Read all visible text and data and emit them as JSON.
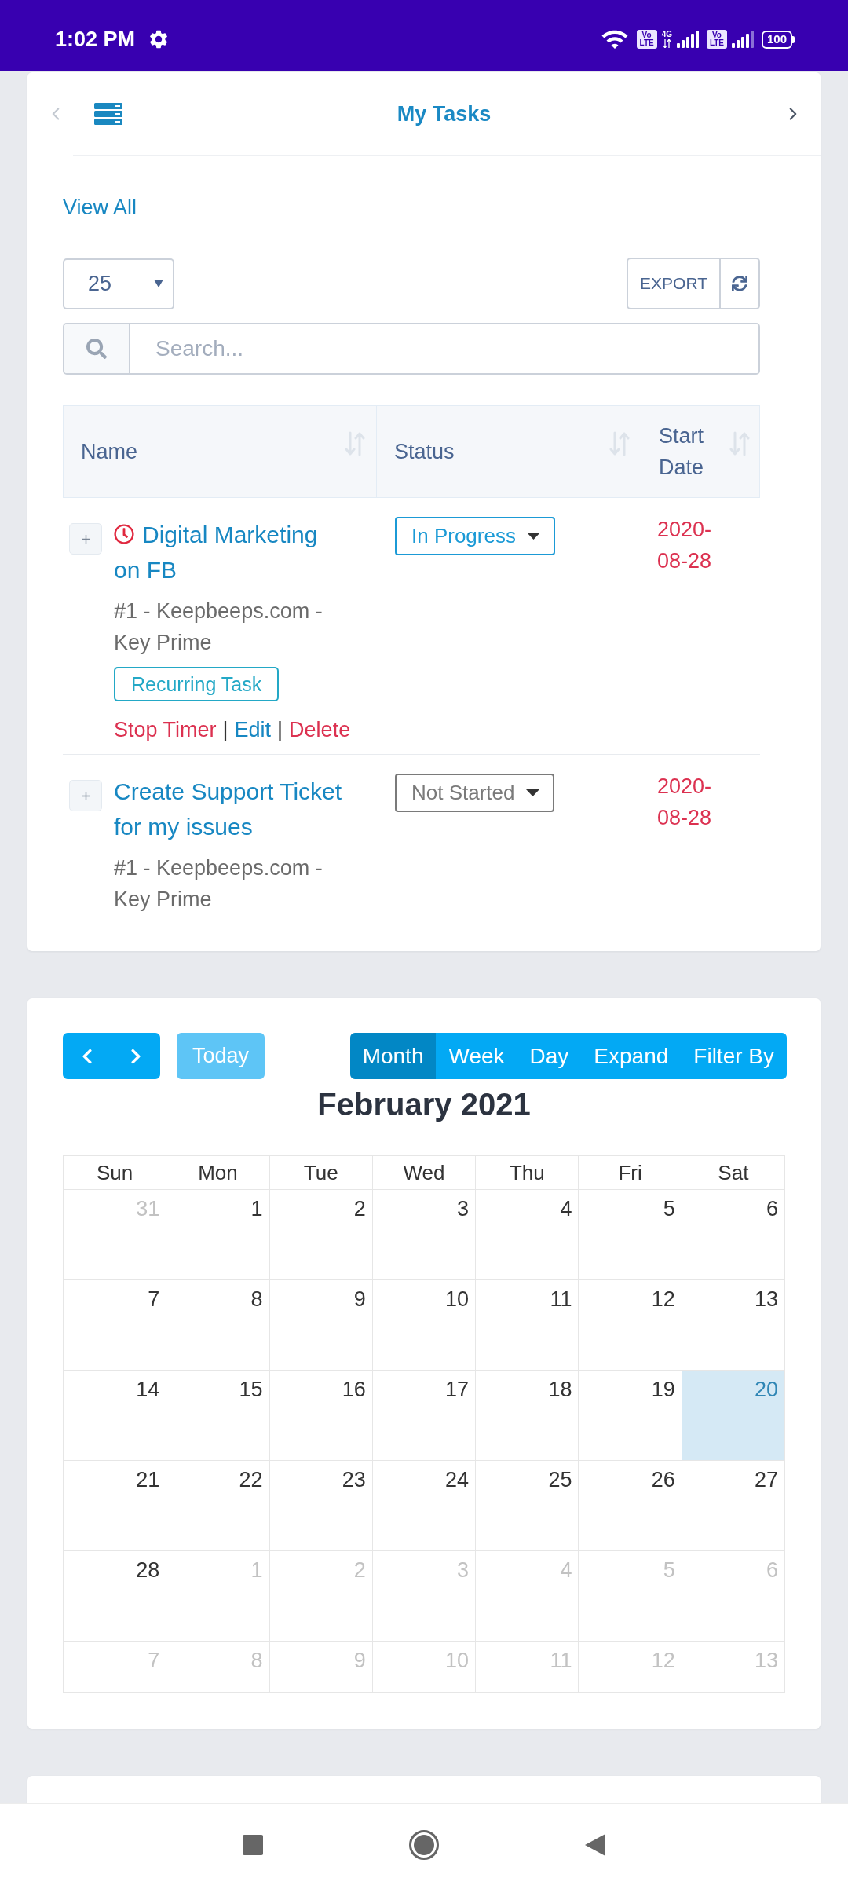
{
  "status_bar": {
    "time": "1:02 PM",
    "sims": [
      {
        "badge": "Vo LTE",
        "network": "4G"
      },
      {
        "badge": "Vo LTE"
      }
    ],
    "battery": "100"
  },
  "tasks": {
    "nav": {
      "prev": {
        "disabled": true
      },
      "next": {
        "disabled": false
      }
    },
    "title": "My Tasks",
    "view_all": "View All",
    "page_size": "25",
    "export": "EXPORT",
    "search": {
      "placeholder": "Search..."
    },
    "columns": [
      "Name",
      "Status",
      "Start Date"
    ],
    "rows": [
      {
        "title": "Digital Marketing on FB",
        "timer_running": true,
        "project": "#1 - Keepbeeps.com - Key Prime",
        "tags": [
          "Recurring Task"
        ],
        "actions": [
          {
            "label": "Stop Timer",
            "kind": "danger"
          },
          {
            "label": "|",
            "kind": "separator"
          },
          {
            "label": "Edit",
            "kind": "link"
          },
          {
            "label": "|",
            "kind": "separator"
          },
          {
            "label": "Delete",
            "kind": "danger"
          }
        ],
        "status": {
          "label": "In Progress",
          "kind": "in_progress"
        },
        "start_date": "2020-08-28"
      },
      {
        "title": "Create Support Ticket for my issues",
        "timer_running": false,
        "project": "#1 - Keepbeeps.com - Key Prime",
        "status": {
          "label": "Not Started",
          "kind": "not_started"
        },
        "start_date": "2020-08-28"
      }
    ]
  },
  "calendar": {
    "today_button": {
      "label": "Today",
      "disabled": true
    },
    "views": [
      {
        "label": "Month",
        "selected": true
      },
      {
        "label": "Week",
        "selected": false
      },
      {
        "label": "Day",
        "selected": false
      },
      {
        "label": "Expand",
        "selected": false
      },
      {
        "label": "Filter By",
        "selected": false
      }
    ],
    "title": "February 2021",
    "weekdays": [
      "Sun",
      "Mon",
      "Tue",
      "Wed",
      "Thu",
      "Fri",
      "Sat"
    ],
    "weeks": [
      [
        {
          "day": "31",
          "other_month": true,
          "today": false
        },
        {
          "day": "1",
          "other_month": false,
          "today": false
        },
        {
          "day": "2",
          "other_month": false,
          "today": false
        },
        {
          "day": "3",
          "other_month": false,
          "today": false
        },
        {
          "day": "4",
          "other_month": false,
          "today": false
        },
        {
          "day": "5",
          "other_month": false,
          "today": false
        },
        {
          "day": "6",
          "other_month": false,
          "today": false
        }
      ],
      [
        {
          "day": "7",
          "other_month": false,
          "today": false
        },
        {
          "day": "8",
          "other_month": false,
          "today": false
        },
        {
          "day": "9",
          "other_month": false,
          "today": false
        },
        {
          "day": "10",
          "other_month": false,
          "today": false
        },
        {
          "day": "11",
          "other_month": false,
          "today": false
        },
        {
          "day": "12",
          "other_month": false,
          "today": false
        },
        {
          "day": "13",
          "other_month": false,
          "today": false
        }
      ],
      [
        {
          "day": "14",
          "other_month": false,
          "today": false
        },
        {
          "day": "15",
          "other_month": false,
          "today": false
        },
        {
          "day": "16",
          "other_month": false,
          "today": false
        },
        {
          "day": "17",
          "other_month": false,
          "today": false
        },
        {
          "day": "18",
          "other_month": false,
          "today": false
        },
        {
          "day": "19",
          "other_month": false,
          "today": false
        },
        {
          "day": "20",
          "other_month": false,
          "today": true
        }
      ],
      [
        {
          "day": "21",
          "other_month": false,
          "today": false
        },
        {
          "day": "22",
          "other_month": false,
          "today": false
        },
        {
          "day": "23",
          "other_month": false,
          "today": false
        },
        {
          "day": "24",
          "other_month": false,
          "today": false
        },
        {
          "day": "25",
          "other_month": false,
          "today": false
        },
        {
          "day": "26",
          "other_month": false,
          "today": false
        },
        {
          "day": "27",
          "other_month": false,
          "today": false
        }
      ],
      [
        {
          "day": "28",
          "other_month": false,
          "today": false
        },
        {
          "day": "1",
          "other_month": true,
          "today": false
        },
        {
          "day": "2",
          "other_month": true,
          "today": false
        },
        {
          "day": "3",
          "other_month": true,
          "today": false
        },
        {
          "day": "4",
          "other_month": true,
          "today": false
        },
        {
          "day": "5",
          "other_month": true,
          "today": false
        },
        {
          "day": "6",
          "other_month": true,
          "today": false
        }
      ],
      [
        {
          "day": "7",
          "other_month": true,
          "today": false
        },
        {
          "day": "8",
          "other_month": true,
          "today": false
        },
        {
          "day": "9",
          "other_month": true,
          "today": false
        },
        {
          "day": "10",
          "other_month": true,
          "today": false
        },
        {
          "day": "11",
          "other_month": true,
          "today": false
        },
        {
          "day": "12",
          "other_month": true,
          "today": false
        },
        {
          "day": "13",
          "other_month": true,
          "today": false
        }
      ]
    ]
  }
}
